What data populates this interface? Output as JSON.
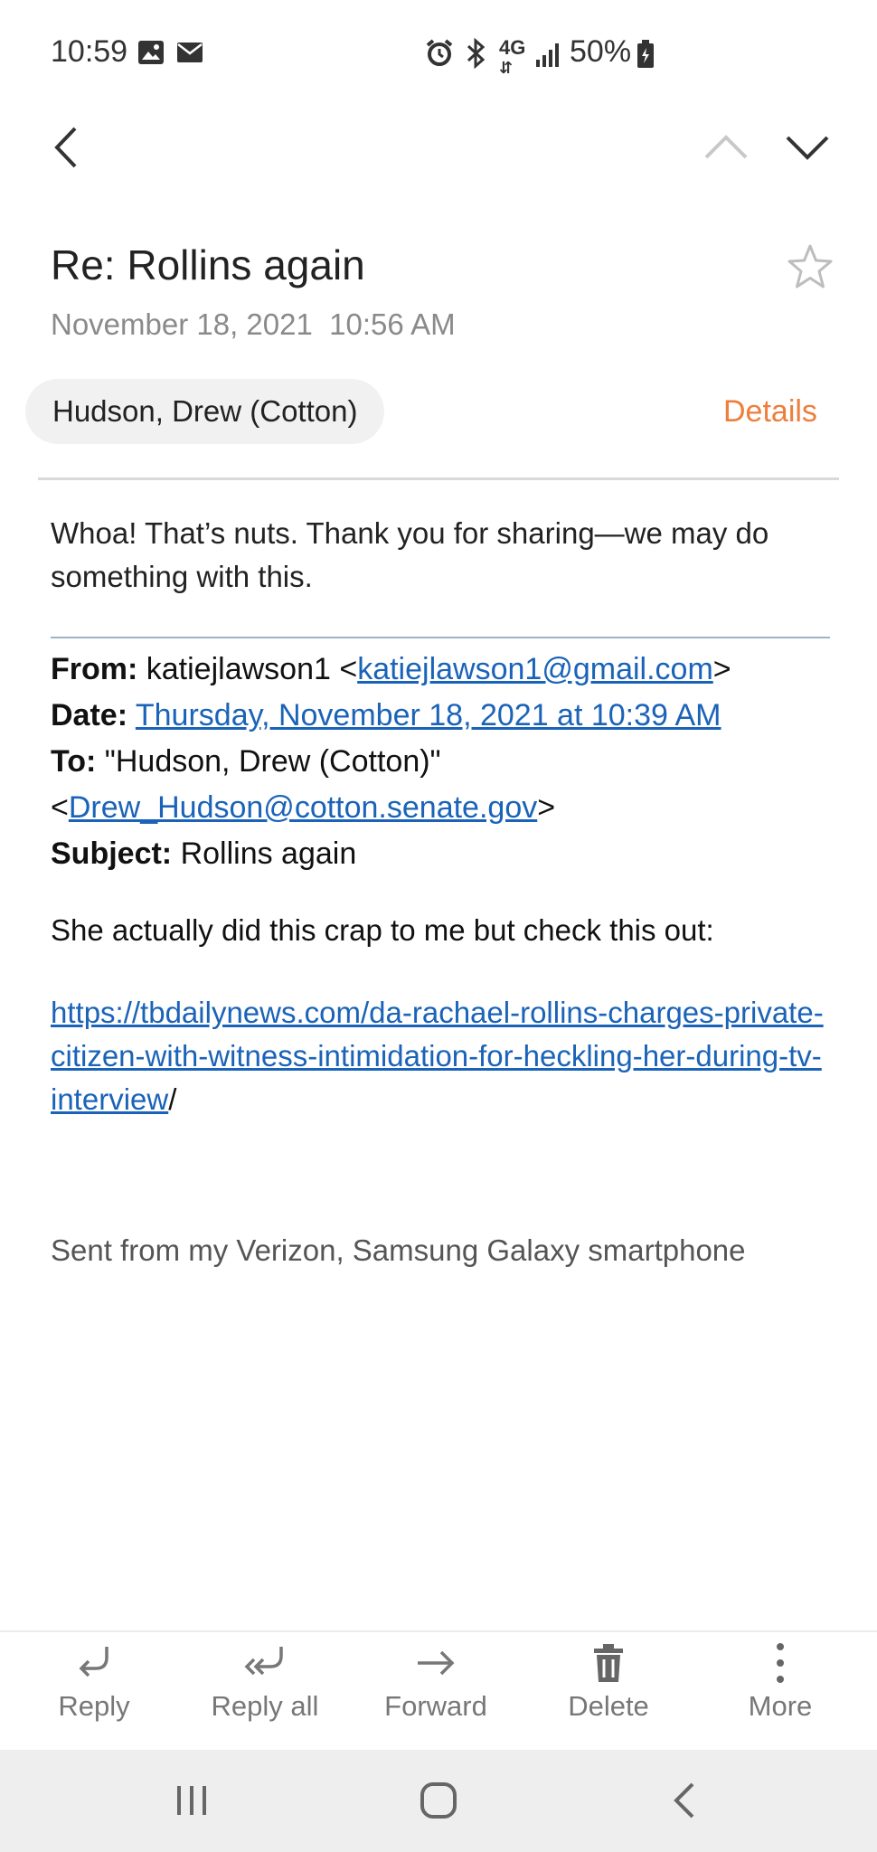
{
  "status_bar": {
    "time": "10:59",
    "battery": "50%",
    "icons": [
      "image-icon",
      "mail-icon",
      "alarm-icon",
      "bluetooth-icon",
      "4g-icon",
      "signal-icon",
      "battery-icon"
    ]
  },
  "nav": {
    "back_icon": "chevron-left-icon",
    "prev_icon": "chevron-up-icon",
    "next_icon": "chevron-down-icon"
  },
  "email": {
    "subject": "Re: Rollins again",
    "date": "November 18, 2021  10:56 AM",
    "sender": "Hudson, Drew (Cotton)",
    "details_label": "Details",
    "body": "Whoa! That’s nuts. Thank you for sharing—we may do something with this.",
    "quoted": {
      "from_label": "From:",
      "from_name": " katiejlawson1 <",
      "from_email": "katiejlawson1@gmail.com",
      "from_close": ">",
      "date_label": "Date:",
      "date_value": "Thursday, November 18, 2021 at 10:39 AM",
      "to_label": "To:",
      "to_name": " \"Hudson, Drew (Cotton)\"",
      "to_open": "<",
      "to_email": "Drew_Hudson@cotton.senate.gov",
      "to_close": ">",
      "subject_label": "Subject:",
      "subject_value": " Rollins again"
    },
    "message": "She actually did this crap to me but check this out:",
    "url": "https://tbdailynews.com/da-rachael-rollins-charges-private-citizen-with-witness-intimidation-for-heckling-her-during-tv-interview",
    "url_trailing": "/",
    "signature": "Sent from my Verizon, Samsung Galaxy smartphone"
  },
  "actions": [
    {
      "label": "Reply",
      "icon": "reply-icon"
    },
    {
      "label": "Reply all",
      "icon": "reply-all-icon"
    },
    {
      "label": "Forward",
      "icon": "forward-icon"
    },
    {
      "label": "Delete",
      "icon": "trash-icon"
    },
    {
      "label": "More",
      "icon": "more-vertical-icon"
    }
  ],
  "system_nav": [
    "recents-icon",
    "home-icon",
    "back-icon"
  ],
  "colors": {
    "accent": "#ee7e3c",
    "link": "#1a63b8",
    "chip_bg": "#f1f1f1",
    "sysnav_bg": "#eeeeee"
  }
}
